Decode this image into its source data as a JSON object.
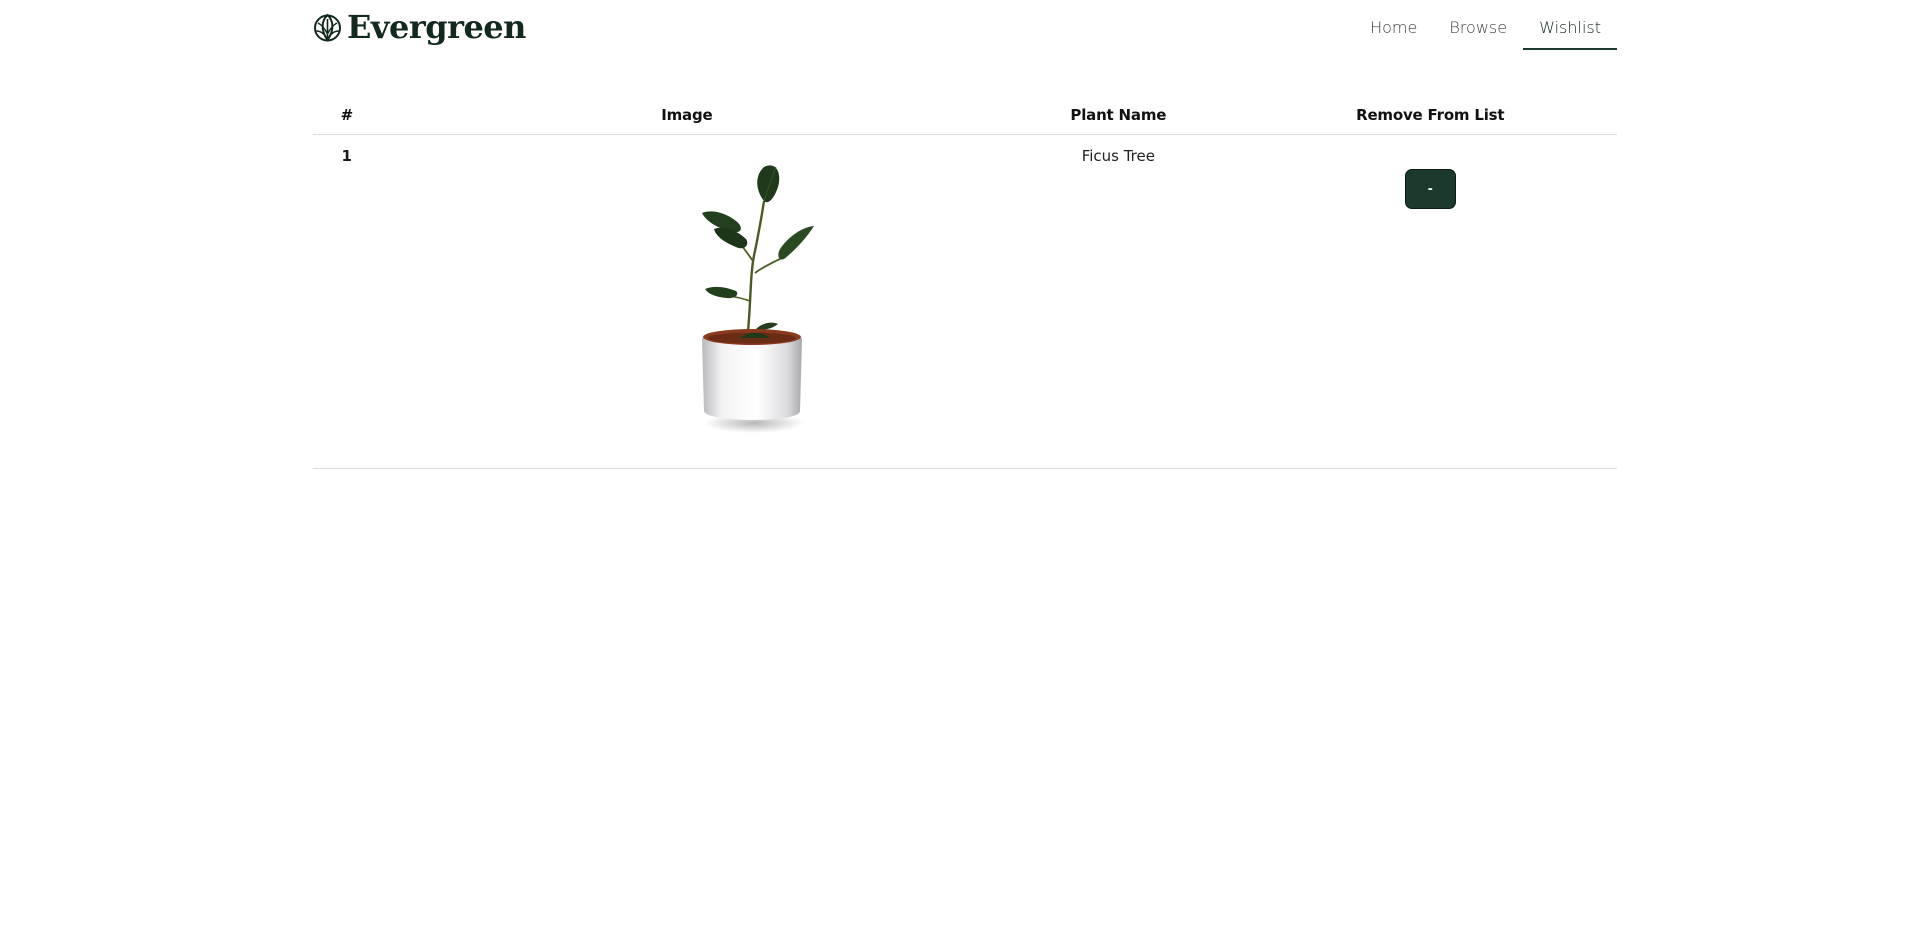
{
  "header": {
    "logo_text": "Evergreen",
    "logo_icon": "leaf-icon",
    "nav": [
      {
        "label": "Home",
        "active": false
      },
      {
        "label": "Browse",
        "active": false
      },
      {
        "label": "Wishlist",
        "active": true
      }
    ]
  },
  "wishlist": {
    "columns": [
      "#",
      "Image",
      "Plant Name",
      "Remove From List"
    ],
    "rows": [
      {
        "number": "1",
        "image": "ficus-tree-photo",
        "plant_name": "Ficus Tree",
        "remove_label": "-"
      }
    ]
  },
  "colors": {
    "brand": "#12291e",
    "button": "#1b3a2d",
    "divider": "#dcdcdc"
  }
}
